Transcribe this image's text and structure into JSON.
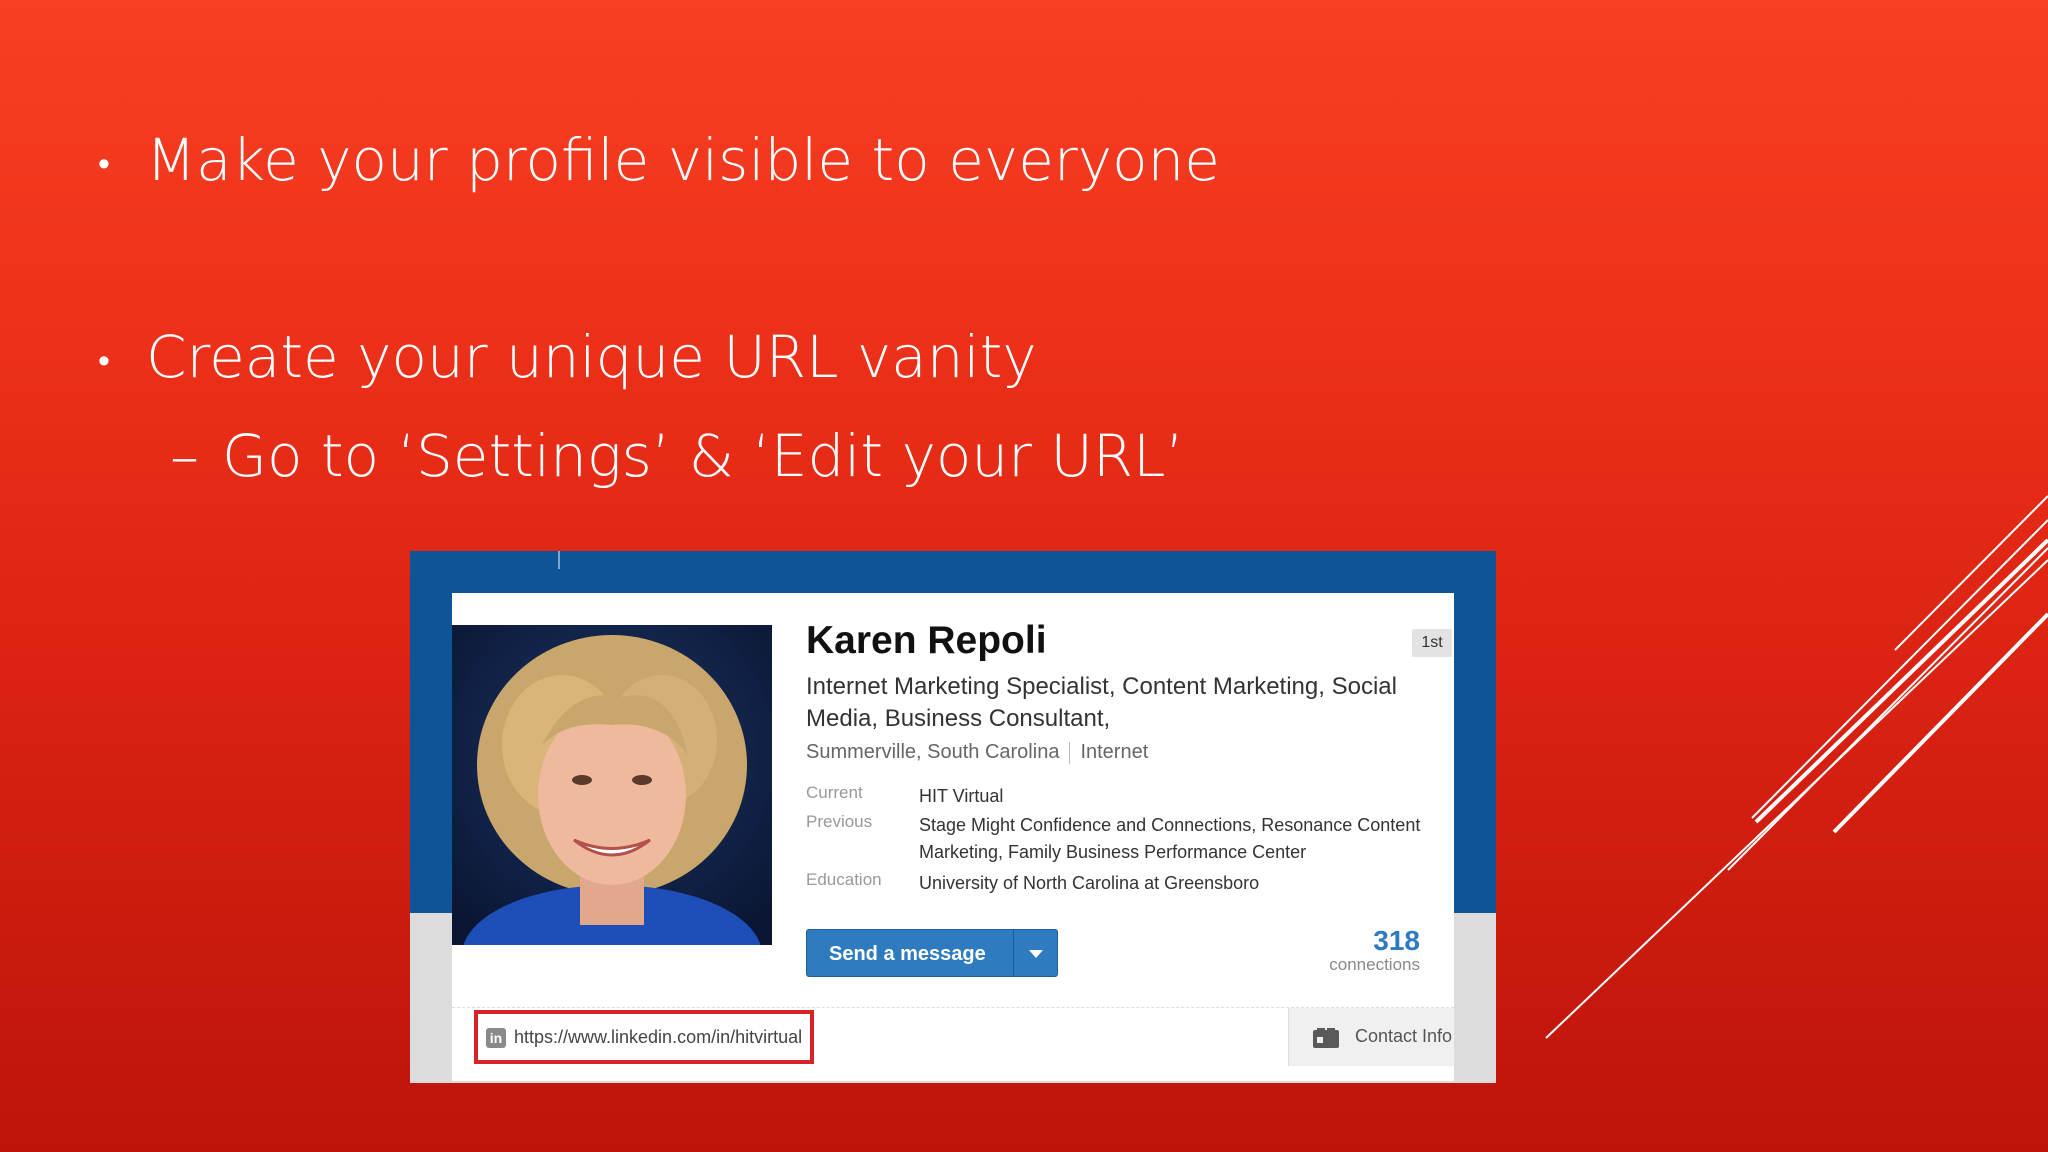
{
  "slide": {
    "bullets": [
      {
        "marker": "•",
        "text": "Make your profile visible to everyone"
      },
      {
        "marker": "•",
        "text": "Create your unique URL vanity"
      }
    ],
    "sub_bullet": {
      "marker": "–",
      "text": "Go to ‘Settings’ & ‘Edit your URL’"
    }
  },
  "profile": {
    "name": "Karen Repoli",
    "degree": "1st",
    "headline": "Internet Marketing Specialist, Content Marketing, Social Media, Business Consultant,",
    "location": "Summerville, South Carolina",
    "industry": "Internet",
    "details": [
      {
        "label": "Current",
        "value": "HIT Virtual"
      },
      {
        "label": "Previous",
        "value": "Stage Might Confidence and Connections, Resonance Content Marketing, Family Business Performance Center"
      },
      {
        "label": "Education",
        "value": "University of North Carolina at Greensboro"
      }
    ],
    "send_message_label": "Send a message",
    "connections_count": "318",
    "connections_label": "connections",
    "public_url": "https://www.linkedin.com/in/hitvirtual",
    "contact_info_label": "Contact Info"
  },
  "icons": {
    "linkedin": "linkedin-icon",
    "contact": "contact-card-icon",
    "dropdown": "chevron-down-icon"
  },
  "colors": {
    "slide_background": "#ec3019",
    "profile_banner": "#0d5596",
    "button_blue": "#2f7bbf",
    "highlight_box": "#d6232a"
  }
}
